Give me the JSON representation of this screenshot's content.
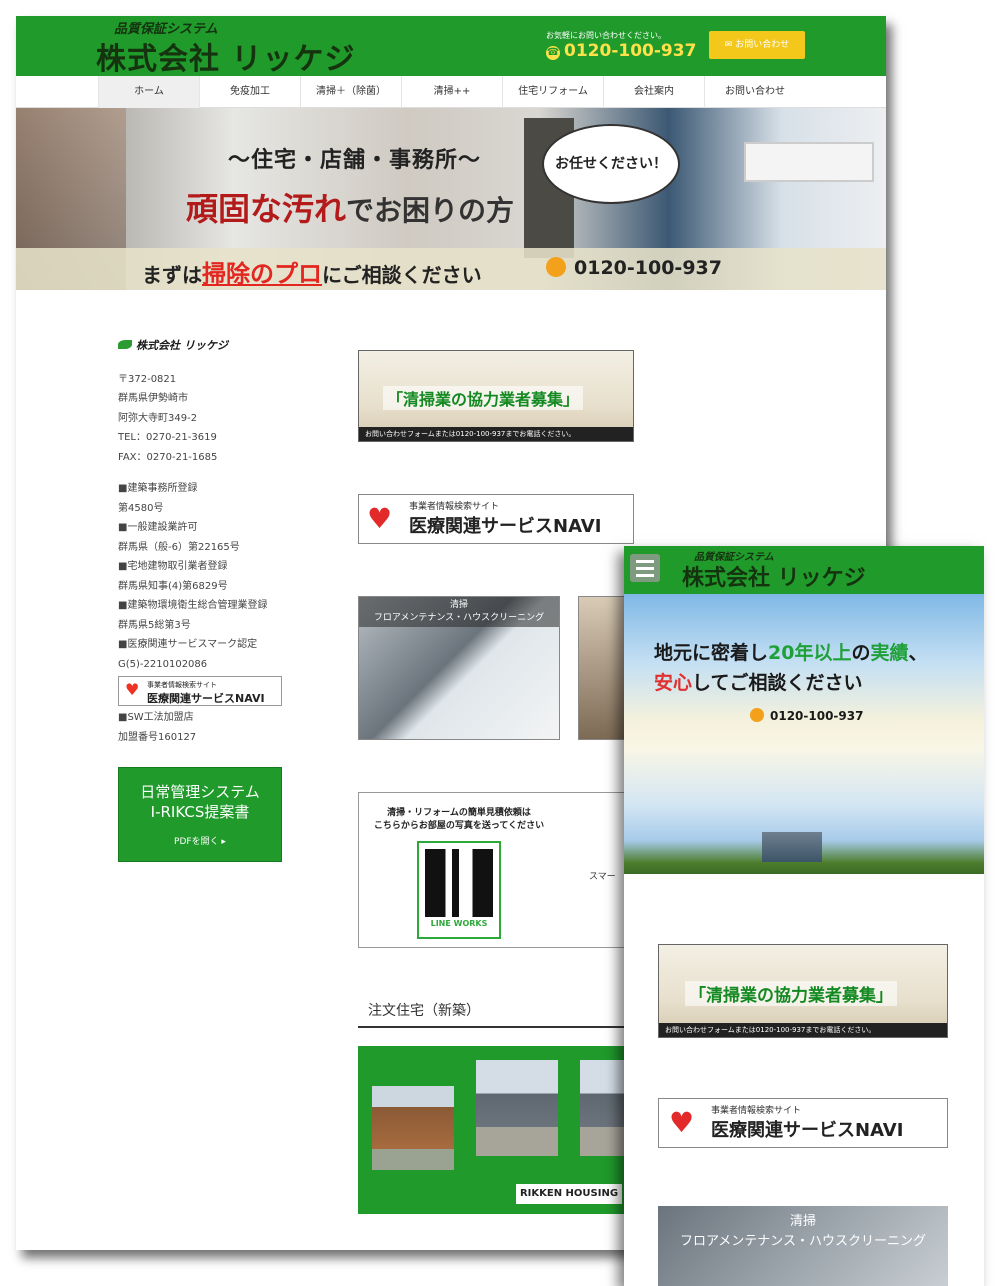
{
  "desktop": {
    "header": {
      "tagline": "品質保証システム",
      "company": "株式会社 リッケジ",
      "contact_note": "お気軽にお問い合わせください。",
      "phone": "0120-100-937",
      "contact_button": "お問い合わせ"
    },
    "nav": [
      "ホーム",
      "免疫加工",
      "清掃＋（除菌）",
      "清掃++",
      "住宅リフォーム",
      "会社案内",
      "お問い合わせ"
    ],
    "hero": {
      "line1": "〜住宅・店舗・事務所〜",
      "line2_em": "頑固な汚れ",
      "line2_rest": "でお困りの方",
      "bubble": "お任せください！",
      "band_pre": "まずは",
      "band_em": "掃除のプロ",
      "band_post": "にご相談ください",
      "band_phone": "0120-100-937"
    },
    "sidebar": {
      "logo": "株式会社 リッケジ",
      "address": [
        "〒372-0821",
        "群馬県伊勢崎市",
        "阿弥大寺町349-2",
        "TEL：0270-21-3619",
        "FAX：0270-21-1685"
      ],
      "licenses": [
        "■建築事務所登録",
        "第4580号",
        "■一般建設業許可",
        "群馬県（般-6）第22165号",
        "■宅地建物取引業者登録",
        "群馬県知事(4)第6829号",
        "■建築物環境衛生総合管理業登録",
        "群馬県5総第3号",
        "■医療関連サービスマーク認定",
        "G(5)-2210102086"
      ],
      "navi_small": "事業者情報検索サイト",
      "navi_main": "医療関連サービスNAVI",
      "licenses2": [
        "■SW工法加盟店",
        "加盟番号160127"
      ],
      "rikcs_line1": "日常管理システム",
      "rikcs_line2": "I-RIKCS提案書",
      "rikcs_pdf": "PDFを開く ▸"
    },
    "main": {
      "recruit_title": "「清掃業の協力業者募集」",
      "recruit_note": "お問い合わせフォームまたは0120-100-937までお電話ください。",
      "navi_sub": "事業者情報検索サイト",
      "navi_main": "医療関連サービスNAVI",
      "service_cap_1": "清掃",
      "service_cap_2": "フロアメンテナンス・ハウスクリーニング",
      "qr_text_1": "清掃・リフォームの簡単見積依頼は",
      "qr_text_2": "こちらからお部屋の写真を送ってください",
      "qr_label": "LINE WORKS",
      "qr_more": "スマー",
      "section_title": "注文住宅（新築）",
      "rikken": "RIKKEN HOUSING"
    }
  },
  "mobile": {
    "tagline": "品質保証システム",
    "company": "株式会社 リッケジ",
    "hero": {
      "l1_a": "地元に密着し",
      "l1_b": "20年以上",
      "l1_c": "の",
      "l1_d": "実績",
      "l1_e": "、",
      "l2_a": "安心",
      "l2_b": "してご相談ください",
      "phone": "0120-100-937"
    },
    "recruit_title": "「清掃業の協力業者募集」",
    "recruit_note": "お問い合わせフォームまたは0120-100-937までお電話ください。",
    "navi_sub": "事業者情報検索サイト",
    "navi_main": "医療関連サービスNAVI",
    "service_cap_1": "清掃",
    "service_cap_2": "フロアメンテナンス・ハウスクリーニング"
  }
}
